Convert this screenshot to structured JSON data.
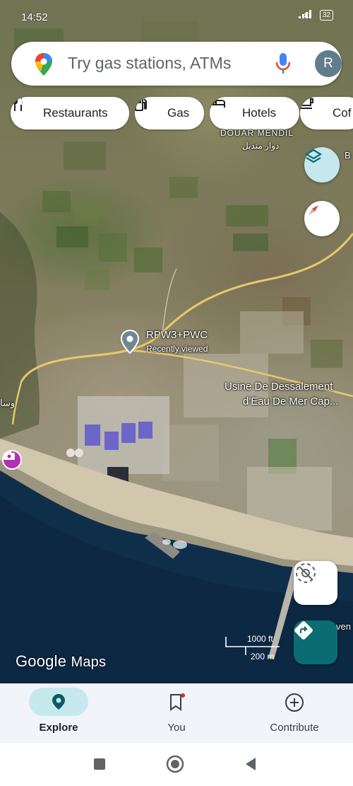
{
  "status_bar": {
    "time": "14:52",
    "network": "4G",
    "battery": "32"
  },
  "search": {
    "placeholder": "Try gas stations, ATMs",
    "avatar_initial": "R"
  },
  "chips": [
    {
      "label": "Restaurants",
      "icon": "fork-knife-icon"
    },
    {
      "label": "Gas",
      "icon": "gas-pump-icon"
    },
    {
      "label": "Hotels",
      "icon": "bed-icon"
    },
    {
      "label": "Cof",
      "icon": "coffee-icon"
    }
  ],
  "map": {
    "labels": {
      "douar_mendil": "DOUAR MENDIL",
      "douar_mendil_ar": "دوار منديل",
      "edge_b": "B",
      "edge_arabic": "وسا",
      "edge_ven": "ven"
    },
    "selected_place": {
      "name": "RPW3+PWC",
      "subtitle": "Recently viewed"
    },
    "poi": {
      "line1": "Usine De Dessalement",
      "line2": "d'Eau De Mer Cap..."
    },
    "scale": {
      "imperial": "1000 ft",
      "metric": "200 m"
    },
    "watermark": {
      "brand": "Google",
      "product": "Maps"
    }
  },
  "bottom_nav": [
    {
      "label": "Explore",
      "icon": "explore-pin-icon",
      "active": true
    },
    {
      "label": "You",
      "icon": "bookmark-icon",
      "active": false
    },
    {
      "label": "Contribute",
      "icon": "plus-circle-icon",
      "active": false
    }
  ],
  "colors": {
    "accent": "#0b6c74",
    "active_pill": "#c6e9ee",
    "nav_background": "#f1f4f8",
    "poi_camera": "#b32fb3"
  }
}
